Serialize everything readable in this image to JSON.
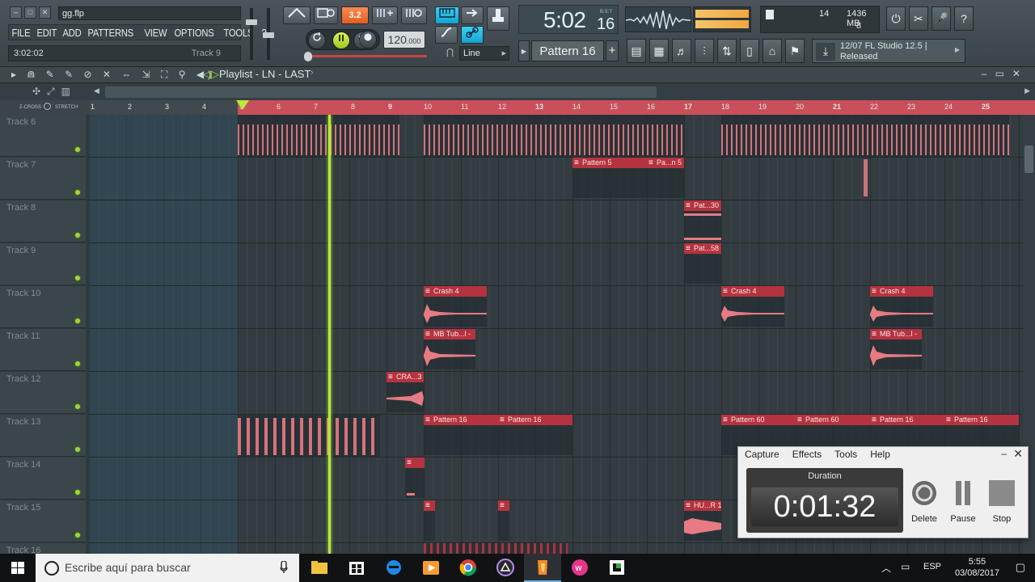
{
  "app": {
    "filename": "gg.flp",
    "menu": [
      "FILE",
      "EDIT",
      "ADD",
      "PATTERNS",
      "VIEW",
      "OPTIONS",
      "TOOLS",
      "?"
    ],
    "hint_left": "3:02:02",
    "hint_right": "Track 9"
  },
  "transport": {
    "pattern_song_label": "3.2",
    "tempo": "120",
    "tempo_decimal": ".000",
    "snap": "Line"
  },
  "time_display": {
    "main": "5:02",
    "seconds": "16",
    "unit": "B:S:T"
  },
  "pattern_selector": {
    "name": "Pattern 16",
    "plus": "+"
  },
  "cpu": {
    "cpu": "14",
    "memory": "1436 MB",
    "polyphony": "8"
  },
  "hint_bar": {
    "line1": "12/07  FL Studio 12.5 |",
    "line2": "Released"
  },
  "playlist": {
    "title": "Playlist - LN - LAST",
    "crossfade_label": "Z-CROSS",
    "stretch_label": "STRETCH",
    "bars": [
      "1",
      "2",
      "3",
      "4",
      "5",
      "6",
      "7",
      "8",
      "9",
      "10",
      "11",
      "12",
      "13",
      "14",
      "15",
      "16",
      "17",
      "18",
      "19",
      "20",
      "21",
      "22",
      "23",
      "24",
      "25"
    ],
    "tracks": [
      "Track 6",
      "Track 7",
      "Track 8",
      "Track 9",
      "Track 10",
      "Track 11",
      "Track 12",
      "Track 13",
      "Track 14",
      "Track 15",
      "Track 16"
    ],
    "clips": [
      {
        "label": "Pattern 5"
      },
      {
        "label": "Pa...n 5"
      },
      {
        "label": "Pat...30"
      },
      {
        "label": "Pat...58"
      },
      {
        "label": "Crash 4"
      },
      {
        "label": "Crash 4"
      },
      {
        "label": "Crash 4"
      },
      {
        "label": "MB Tub...l -"
      },
      {
        "label": "MB Tub...l -"
      },
      {
        "label": "CRA...3"
      },
      {
        "label": "Pattern 16"
      },
      {
        "label": "Pattern 16"
      },
      {
        "label": "Pattern 60"
      },
      {
        "label": "Pattern 60"
      },
      {
        "label": "Pattern 16"
      },
      {
        "label": "Pattern 16"
      },
      {
        "label": "HU...R 1"
      }
    ]
  },
  "recorder": {
    "menu": [
      "Capture",
      "Effects",
      "Tools",
      "Help"
    ],
    "duration_label": "Duration",
    "duration": "0:01:32",
    "delete": "Delete",
    "pause": "Pause",
    "stop": "Stop"
  },
  "taskbar": {
    "search_placeholder": "Escribe aquí para buscar",
    "language": "ESP",
    "time": "5:55",
    "date": "03/08/2017"
  },
  "colors": {
    "clip_header": "#b5333f",
    "note": "#e87a84",
    "playhead": "#b9ea3a",
    "accent_orange": "#e25c21"
  }
}
